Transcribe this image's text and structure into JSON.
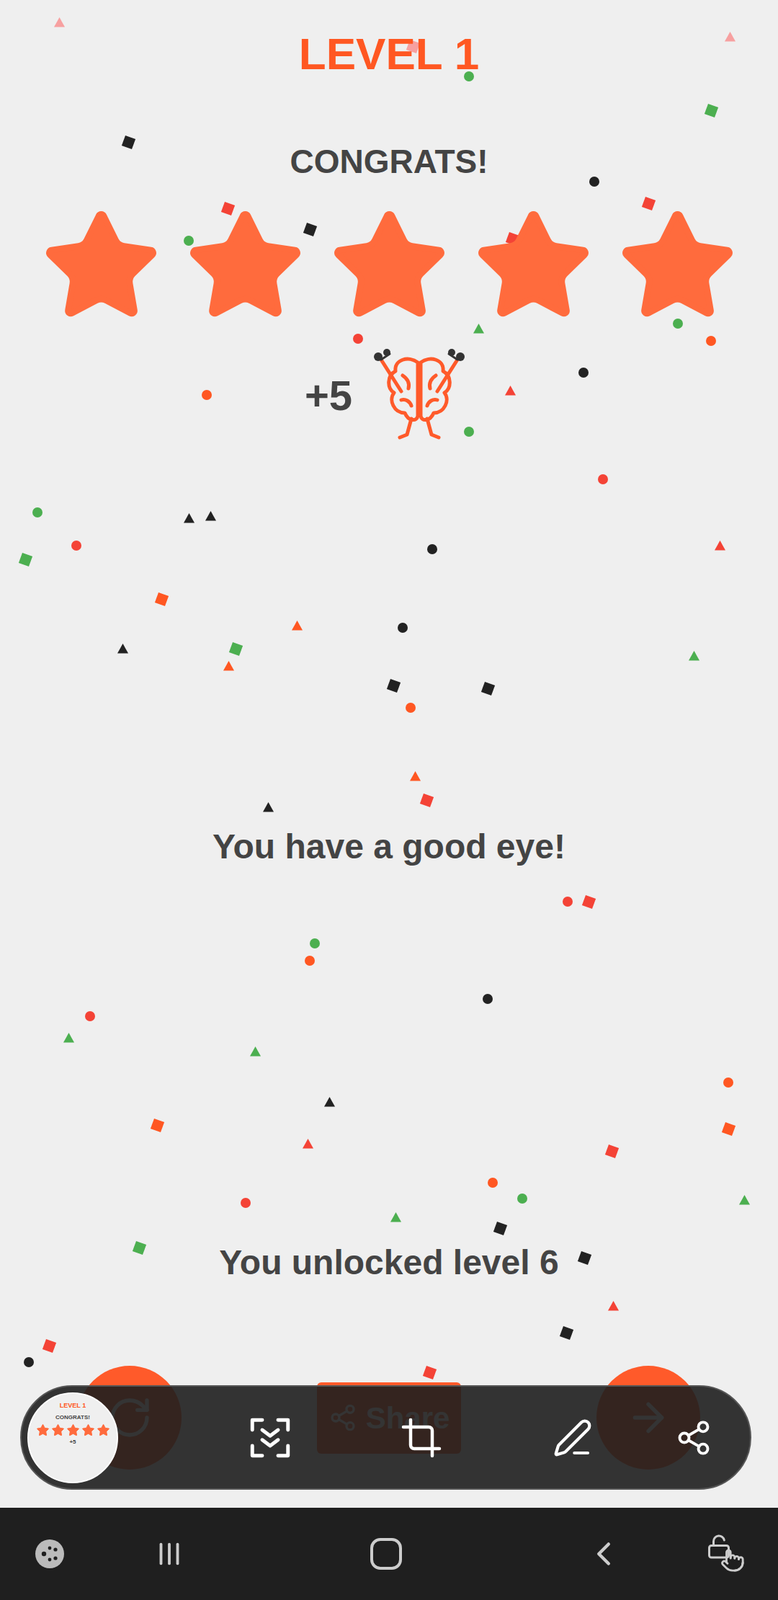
{
  "level_title": "LEVEL 1",
  "message": "CONGRATS!",
  "rating": {
    "stars": 5,
    "max": 5
  },
  "reward": {
    "points": "+5"
  },
  "praise": "You have a good eye!",
  "unlock": "You unlocked level 6",
  "share_button": {
    "label": "Share"
  },
  "screenshot_toolbar": {
    "thumbnail": {
      "title": "LEVEL 1",
      "message": "CONGRATS!",
      "stars": 5,
      "reward": "+5"
    }
  }
}
